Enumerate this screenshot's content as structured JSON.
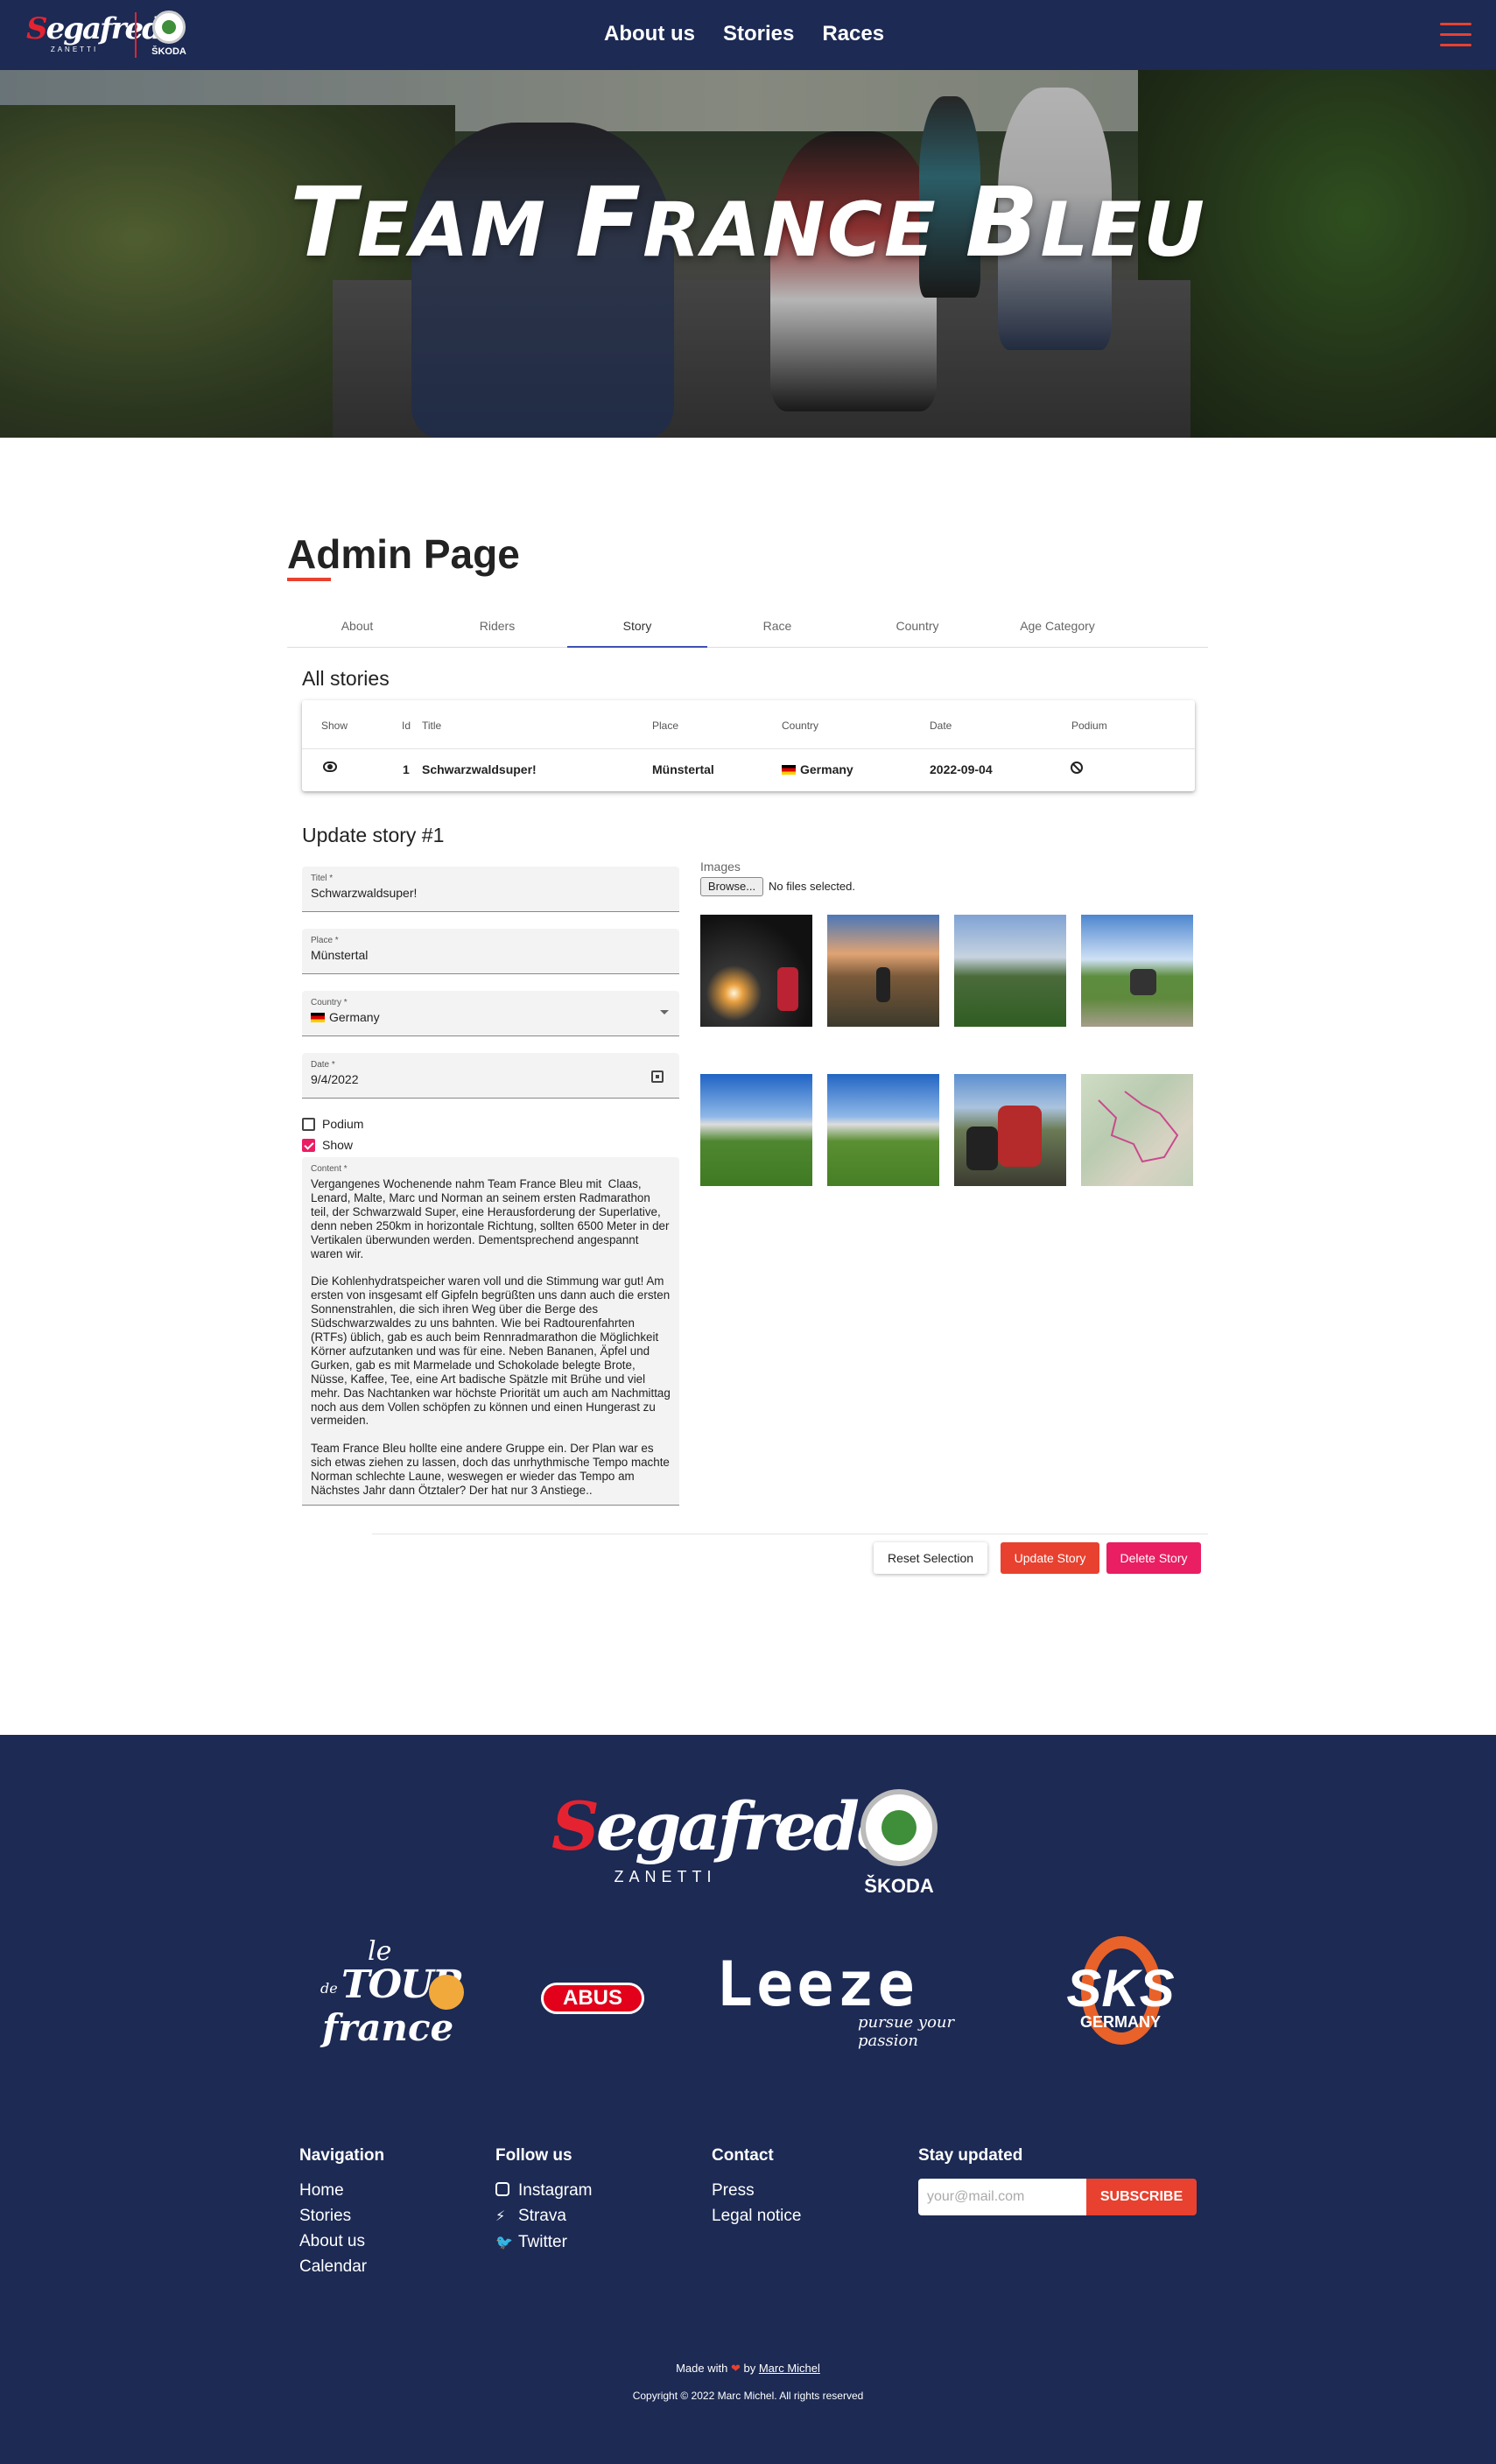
{
  "header": {
    "brand_main": "Segafredo",
    "brand_sub": "ZANETTI",
    "partner": "ŠKODA",
    "nav": [
      "About us",
      "Stories",
      "Races"
    ]
  },
  "hero": {
    "title_a": "T",
    "title_b": "EAM ",
    "title_c": "F",
    "title_d": "RANCE ",
    "title_e": "B",
    "title_f": "LEU"
  },
  "admin": {
    "title": "Admin Page",
    "tabs": [
      "About",
      "Riders",
      "Story",
      "Race",
      "Country",
      "Age Category"
    ],
    "active_tab": "Story"
  },
  "stories": {
    "title": "All stories",
    "columns": [
      "Show",
      "Id",
      "Title",
      "Place",
      "Country",
      "Date",
      "Podium"
    ],
    "rows": [
      {
        "show": "eye-icon",
        "id": "1",
        "title": "Schwarzwaldsuper!",
        "place": "Münstertal",
        "country": "Germany",
        "date": "2022-09-04",
        "podium": "ban-icon"
      }
    ]
  },
  "form": {
    "title": "Update story #1",
    "title_label": "Titel *",
    "title_value": "Schwarzwaldsuper!",
    "place_label": "Place *",
    "place_value": "Münstertal",
    "country_label": "Country *",
    "country_value": "Germany",
    "date_label": "Date *",
    "date_value": "9/4/2022",
    "podium_label": "Podium",
    "podium_checked": false,
    "show_label": "Show",
    "show_checked": true,
    "content_label": "Content *",
    "content_value": "Vergangenes Wochenende nahm Team France Bleu mit  Claas, Lenard, Malte, Marc und Norman an seinem ersten Radmarathon teil, der Schwarzwald Super, eine Herausforderung der Superlative, denn neben 250km in horizontale Richtung, sollten 6500 Meter in der Vertikalen überwunden werden. Dementsprechend angespannt waren wir.\n\nDie Kohlenhydratspeicher waren voll und die Stimmung war gut! Am ersten von insgesamt elf Gipfeln begrüßten uns dann auch die ersten Sonnenstrahlen, die sich ihren Weg über die Berge des Südschwarzwaldes zu uns bahnten. Wie bei Radtourenfahrten (RTFs) üblich, gab es auch beim Rennradmarathon die Möglichkeit Körner aufzutanken und was für eine. Neben Bananen, Äpfel und Gurken, gab es mit Marmelade und Schokolade belegte Brote, Nüsse, Kaffee, Tee, eine Art badische Spätzle mit Brühe und viel mehr. Das Nachtanken war höchste Priorität um auch am Nachmittag noch aus dem Vollen schöpfen zu können und einen Hungerast zu vermeiden.\n\nTeam France Bleu hollte eine andere Gruppe ein. Der Plan war es sich etwas ziehen zu lassen, doch das unrhythmische Tempo machte Norman schlechte Laune, weswegen er wieder das Tempo am Nächstes Jahr dann Ötztaler? Der hat nur 3 Anstiege..",
    "images_label": "Images",
    "browse_label": "Browse...",
    "no_files": "No files selected.",
    "reset_label": "Reset Selection",
    "update_label": "Update Story",
    "delete_label": "Delete Story"
  },
  "footer": {
    "sponsor_tour_a": "le",
    "sponsor_tour_b": "TOUR",
    "sponsor_tour_c": "de",
    "sponsor_tour_d": "france",
    "sponsor_abus": "ABUS",
    "sponsor_leeze": "Leeze",
    "sponsor_leeze_tag": "pursue your passion",
    "sponsor_sks": "SKS",
    "sponsor_sks_sub": "GERMANY",
    "nav_title": "Navigation",
    "nav_items": [
      "Home",
      "Stories",
      "About us",
      "Calendar"
    ],
    "follow_title": "Follow us",
    "follow_items": [
      "Instagram",
      "Strava",
      "Twitter"
    ],
    "contact_title": "Contact",
    "contact_items": [
      "Press",
      "Legal notice"
    ],
    "stay_title": "Stay updated",
    "email_placeholder": "your@mail.com",
    "subscribe_label": "SUBSCRIBE",
    "made_prefix": "Made with",
    "made_by": "by",
    "made_author": "Marc Michel",
    "copyright": "Copyright © 2022 Marc Michel. All rights reserved"
  },
  "colors": {
    "navy": "#1c2a54",
    "accent": "#e8412f",
    "pink": "#e91e63",
    "tab_indicator": "#3f51b5"
  }
}
